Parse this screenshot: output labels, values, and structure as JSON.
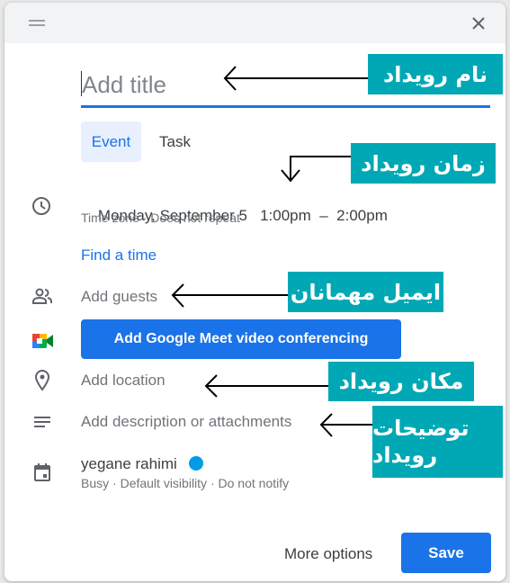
{
  "header": {
    "drag_icon": "drag-handle-icon",
    "close_icon": "close-icon"
  },
  "title_input": {
    "placeholder": "Add title",
    "value": ""
  },
  "tabs": [
    {
      "label": "Event",
      "selected": true
    },
    {
      "label": "Task",
      "selected": false
    }
  ],
  "datetime": {
    "date": "Monday, September 5",
    "start": "1:00pm",
    "separator": "–",
    "end": "2:00pm",
    "timezone": "Time zone",
    "repeat": "Does not repeat",
    "dot": "·"
  },
  "find_time": "Find a time",
  "guests_placeholder": "Add guests",
  "meet_button": "Add Google Meet video conferencing",
  "location_placeholder": "Add location",
  "description_placeholder": "Add description or attachments",
  "calendar": {
    "owner": "yegane rahimi",
    "color": "#039be5",
    "busy": "Busy",
    "visibility": "Default visibility",
    "notify": "Do not notify"
  },
  "footer": {
    "more_options": "More options",
    "save": "Save"
  },
  "annotations": {
    "title": "نام رویداد",
    "time": "زمان رویداد",
    "guests": "ایمیل مهمانان",
    "location": "مکان رویداد",
    "description_line1": "توضیحات",
    "description_line2": "رویداد"
  },
  "colors": {
    "accent": "#1a73e8",
    "annotation_bg": "#00a8b5"
  }
}
